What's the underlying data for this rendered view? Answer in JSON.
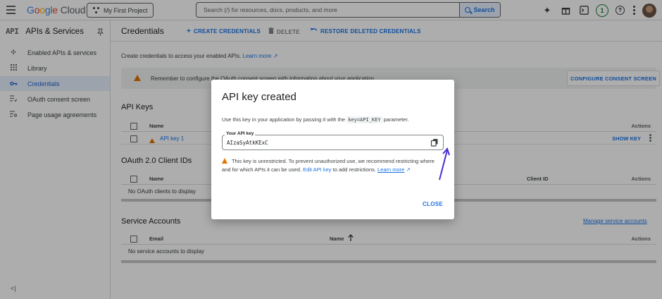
{
  "topbar": {
    "brand": "Google",
    "product": "Cloud",
    "project": "My First Project",
    "search_placeholder": "Search (/) for resources, docs, products, and more",
    "search_button": "Search",
    "notifications_count": "1",
    "help_glyph": "?"
  },
  "sidebar": {
    "api_mark": "API",
    "title": "APIs & Services",
    "items": [
      {
        "label": "Enabled APIs & services",
        "icon": "apis-icon"
      },
      {
        "label": "Library",
        "icon": "library-icon"
      },
      {
        "label": "Credentials",
        "icon": "key-icon",
        "active": true
      },
      {
        "label": "OAuth consent screen",
        "icon": "consent-icon"
      },
      {
        "label": "Page usage agreements",
        "icon": "agreements-icon"
      }
    ],
    "collapse_glyph": "<|"
  },
  "main": {
    "title": "Credentials",
    "actions": {
      "create": "CREATE CREDENTIALS",
      "delete": "DELETE",
      "restore": "RESTORE DELETED CREDENTIALS"
    },
    "intro": "Create credentials to access your enabled APIs.",
    "intro_link": "Learn more",
    "banner_text": "Remember to configure the OAuth consent screen with information about your application.",
    "banner_button": "CONFIGURE CONSENT SCREEN",
    "api_keys": {
      "title": "API Keys",
      "columns": [
        "Name",
        "Actions"
      ],
      "row_name": "API key 1",
      "row_action": "SHOW KEY"
    },
    "oauth": {
      "title": "OAuth 2.0 Client IDs",
      "columns": [
        "Name",
        "Client ID",
        "Actions"
      ],
      "empty": "No OAuth clients to display"
    },
    "service_accounts": {
      "title": "Service Accounts",
      "manage_link": "Manage service accounts",
      "columns": [
        "Email",
        "Name",
        "Actions"
      ],
      "empty": "No service accounts to display"
    }
  },
  "dialog": {
    "title": "API key created",
    "desc_before": "Use this key in your application by passing it with the",
    "desc_code": "key=API_KEY",
    "desc_after": "parameter.",
    "key_label": "Your API key",
    "key_value": "AIzaSyAtkKExC",
    "warning_text": "This key is unrestricted. To prevent unauthorized use, we recommend restricting where and for which APIs it can be used.",
    "warning_link": "Edit API key",
    "warning_after": "to add restrictions.",
    "warning_learn": "Learn more",
    "close": "CLOSE"
  },
  "colors": {
    "accent": "#1a73e8",
    "warning": "#e37400",
    "annotation_arrow": "#4a2fd6"
  }
}
